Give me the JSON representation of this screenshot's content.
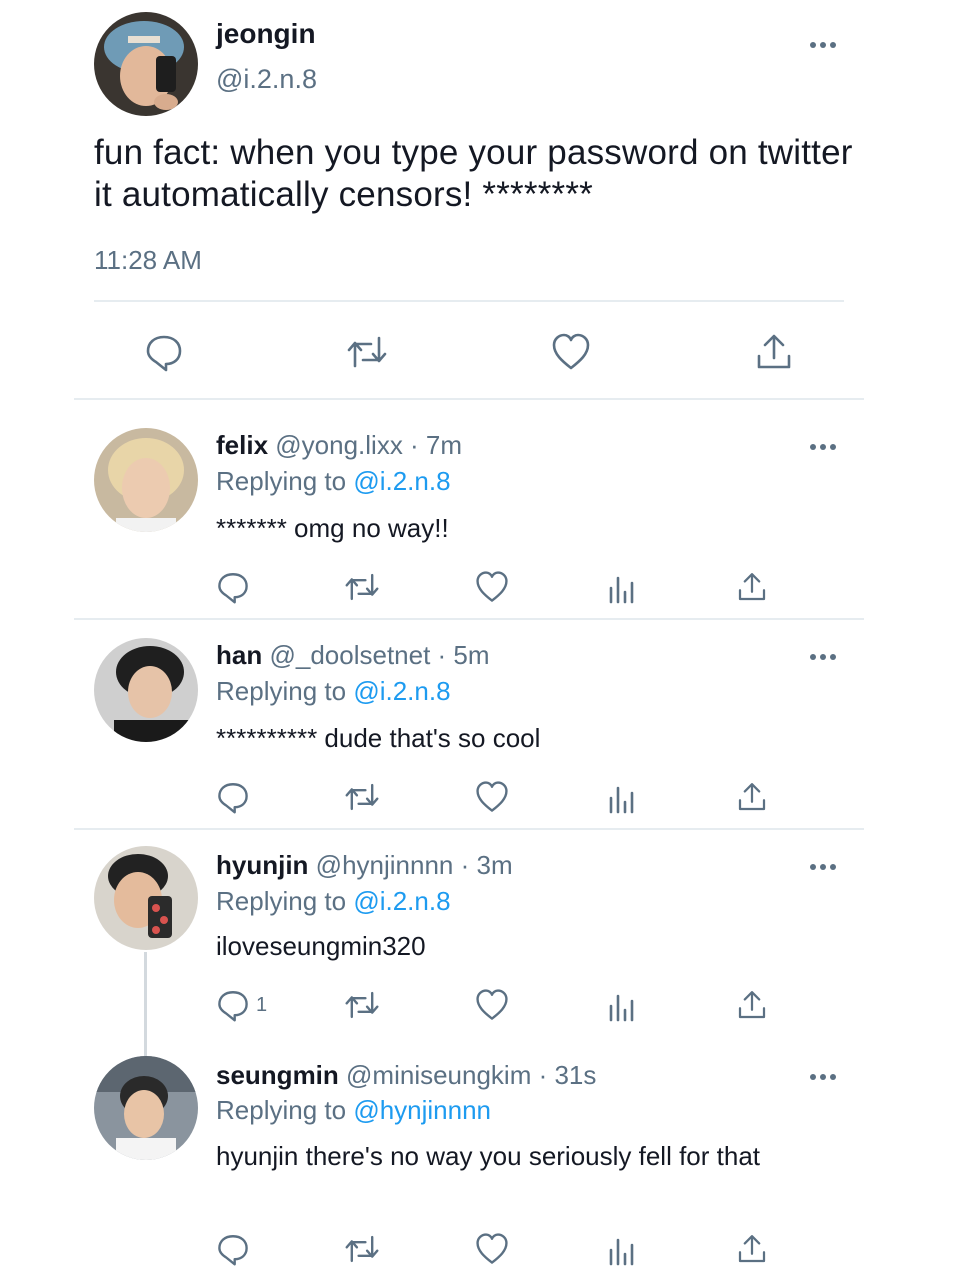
{
  "main": {
    "name": "jeongin",
    "handle": "@i.2.n.8",
    "text": "fun fact: when you type your password on twitter it automatically censors! ********",
    "time": "11:28 AM"
  },
  "replies": [
    {
      "name": "felix",
      "handle": "@yong.lixx · 7m",
      "replying_label": "Replying to",
      "replying_to": "@i.2.n.8",
      "text": "******* omg no way!!"
    },
    {
      "name": "han",
      "handle": "@_doolsetnet · 5m",
      "replying_label": "Replying to",
      "replying_to": "@i.2.n.8",
      "text": "********** dude that's so cool"
    },
    {
      "name": "hyunjin",
      "handle": "@hynjinnnn · 3m",
      "replying_label": "Replying to",
      "replying_to": "@i.2.n.8",
      "text": "iloveseungmin320",
      "reply_count": "1"
    },
    {
      "name": "seungmin",
      "handle": "@miniseungkim · 31s",
      "replying_label": "Replying to",
      "replying_to": "@hynjinnnn",
      "text": "hyunjin there's no way you seriously fell for that"
    }
  ],
  "icons": [
    "more-icon",
    "reply-icon",
    "retweet-icon",
    "like-icon",
    "analytics-icon",
    "share-icon"
  ],
  "colors": {
    "text": "#141823",
    "secondary": "#5b7083",
    "link": "#1d9bf0",
    "divider": "#e6ecf0"
  }
}
